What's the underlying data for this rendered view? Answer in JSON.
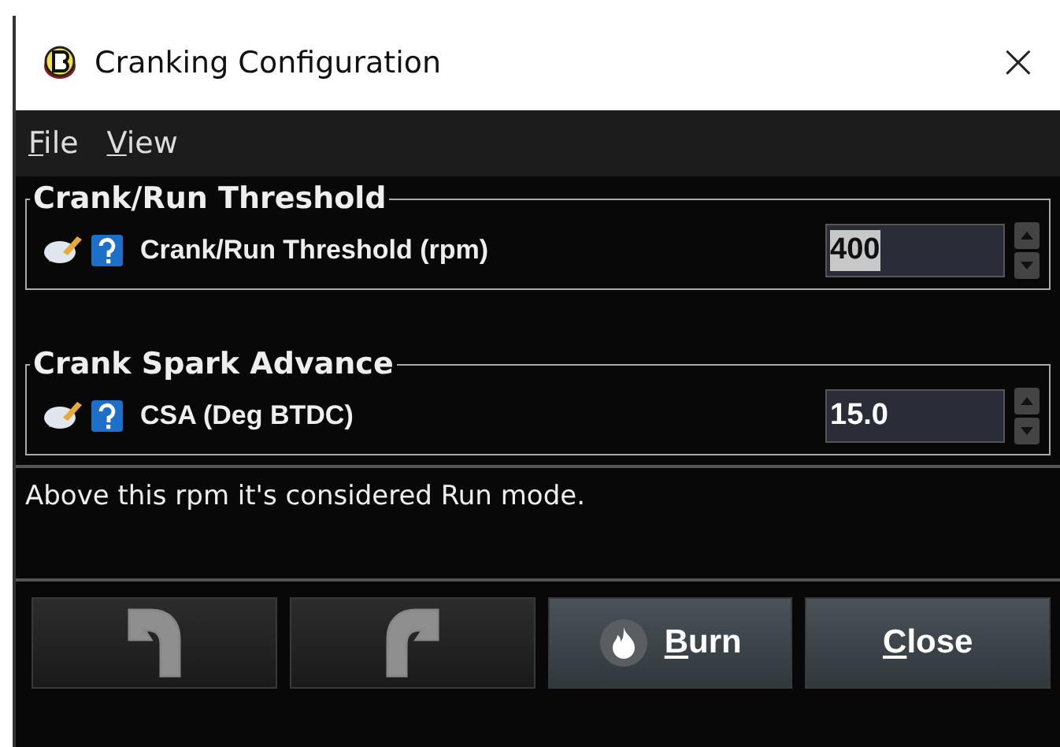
{
  "window": {
    "title": "Cranking Configuration",
    "close": "×"
  },
  "menu": [
    {
      "label": "File"
    },
    {
      "label": "View"
    }
  ],
  "groups": [
    {
      "title": "Crank/Run Threshold",
      "field": {
        "label": "Crank/Run Threshold (rpm)",
        "value": "400",
        "highlighted": true
      }
    },
    {
      "title": "Crank Spark Advance",
      "field": {
        "label": "CSA (Deg BTDC)",
        "value": "15.0",
        "highlighted": false
      }
    }
  ],
  "help_text": "Above this rpm it's considered Run mode.",
  "buttons": [
    {
      "kind": "undo",
      "disabled": true
    },
    {
      "kind": "redo",
      "disabled": true
    },
    {
      "kind": "burn",
      "label": "Burn",
      "disabled": false
    },
    {
      "kind": "close",
      "label": "Close",
      "disabled": false
    }
  ]
}
